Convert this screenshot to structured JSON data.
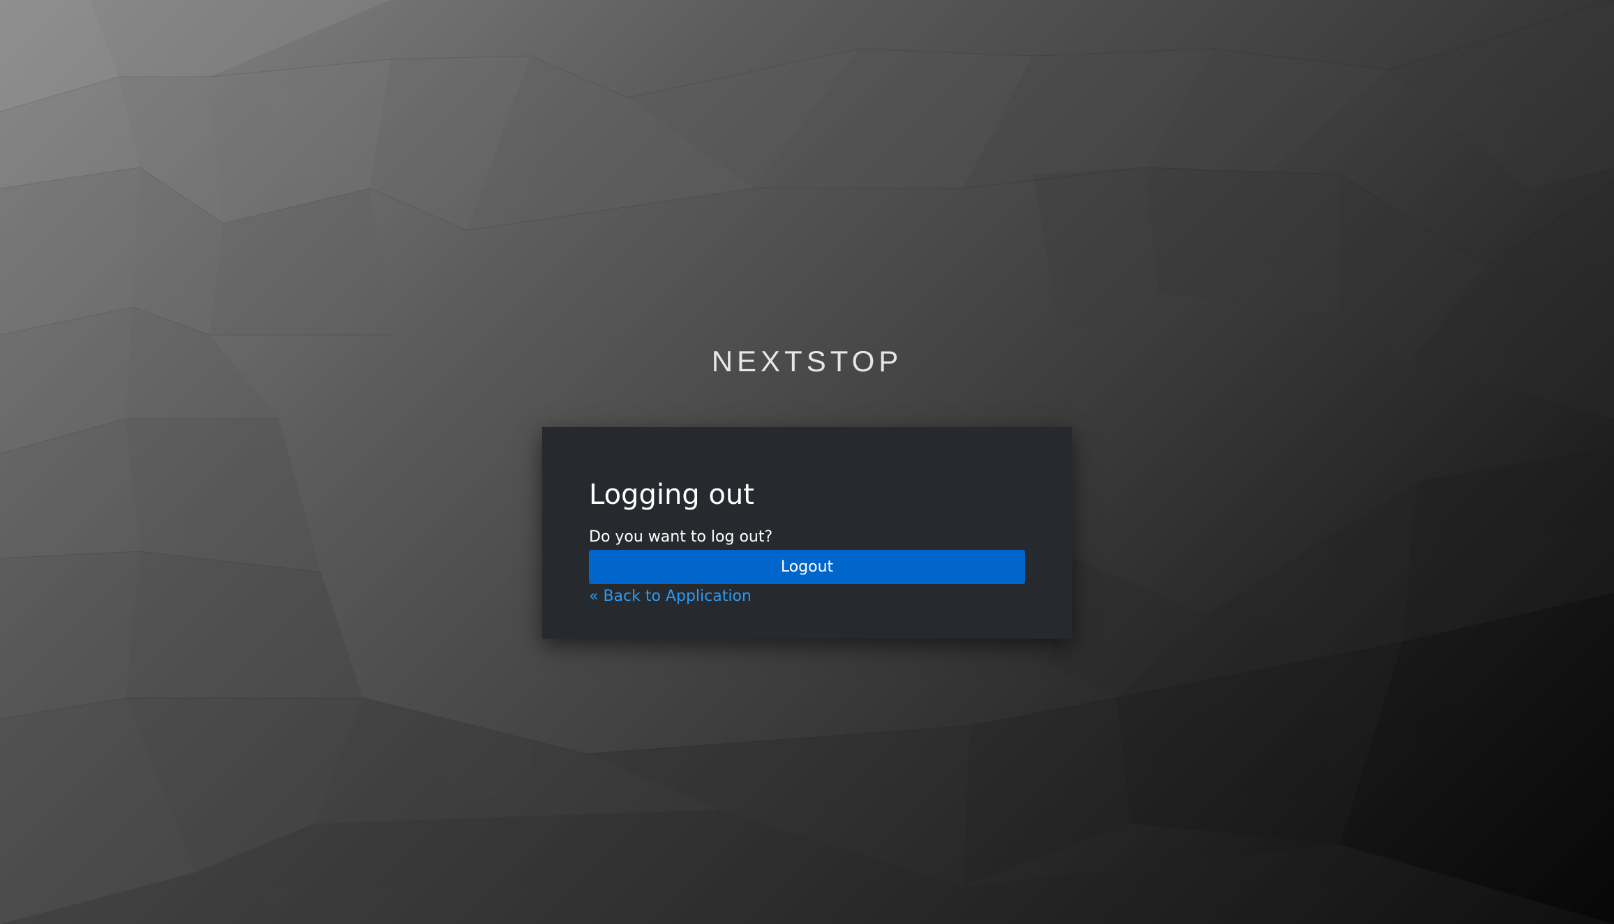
{
  "brand": {
    "name": "NEXTSTOP"
  },
  "logout_card": {
    "title": "Logging out",
    "prompt": "Do you want to log out?",
    "logout_button": "Logout",
    "back_link": "« Back to Application"
  },
  "colors": {
    "card_background": "#26292e",
    "primary_button": "#0066cc",
    "link": "#2b9af3",
    "text": "#ffffff"
  }
}
